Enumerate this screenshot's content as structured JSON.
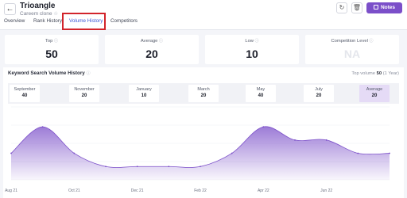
{
  "header": {
    "title": "Trioangle",
    "subtitle": "Careem clone",
    "notes_label": "Notes"
  },
  "tabs": [
    {
      "label": "Overview",
      "active": false
    },
    {
      "label": "Rank History",
      "active": false
    },
    {
      "label": "Volume History",
      "active": true
    },
    {
      "label": "Competitors",
      "active": false
    }
  ],
  "stats": [
    {
      "label": "Top",
      "value": "50"
    },
    {
      "label": "Average",
      "value": "20"
    },
    {
      "label": "Low",
      "value": "10"
    },
    {
      "label": "Competition Level",
      "value": "NA"
    }
  ],
  "panel": {
    "title": "Keyword Search Volume History",
    "top_volume_prefix": "Top volume",
    "top_volume_value": "50",
    "top_volume_suffix": "(1 Year)"
  },
  "months": [
    {
      "name": "September",
      "value": "40"
    },
    {
      "name": "November",
      "value": "20"
    },
    {
      "name": "January",
      "value": "10"
    },
    {
      "name": "March",
      "value": "20"
    },
    {
      "name": "May",
      "value": "40"
    },
    {
      "name": "July",
      "value": "20"
    },
    {
      "name": "Average",
      "value": "20"
    }
  ],
  "chart_data": {
    "type": "area",
    "x": [
      "Aug 21",
      "Sep 21",
      "Oct 21",
      "Nov 21",
      "Dec 21",
      "Jan 22",
      "Feb 22",
      "Mar 22",
      "Apr 22",
      "May 22",
      "Jun 22",
      "Jul 22",
      "Aug 22"
    ],
    "tick_labels": [
      "Aug 21",
      "Oct 21",
      "Dec 21",
      "Feb 22",
      "Apr 22",
      "Jun 22"
    ],
    "series": [
      {
        "values": [
          20,
          40,
          20,
          10,
          10,
          10,
          10,
          20,
          40,
          30,
          30,
          20,
          20
        ]
      }
    ],
    "ylim": [
      0,
      55
    ],
    "grid": true,
    "color": "#7b4fc9"
  }
}
